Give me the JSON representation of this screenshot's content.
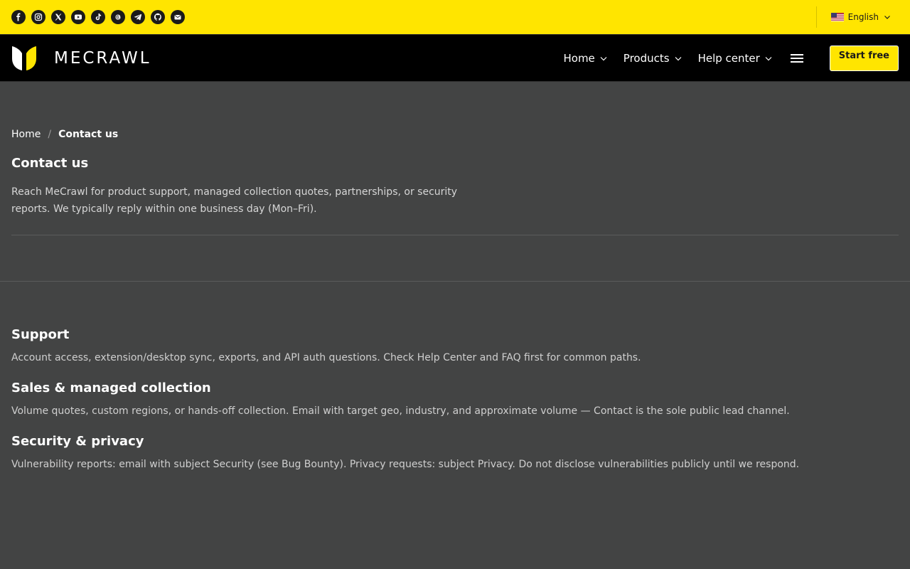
{
  "topbar": {
    "socials": [
      {
        "icon": "facebook-icon"
      },
      {
        "icon": "instagram-icon"
      },
      {
        "icon": "x-twitter-icon"
      },
      {
        "icon": "youtube-icon"
      },
      {
        "icon": "tiktok-icon"
      },
      {
        "icon": "threads-icon"
      },
      {
        "icon": "telegram-icon"
      },
      {
        "icon": "github-icon"
      },
      {
        "icon": "email-icon"
      }
    ],
    "language": {
      "label": "English",
      "flag": "us-flag-icon"
    }
  },
  "nav": {
    "brand": "MECRAWL",
    "links": [
      {
        "label": "Home"
      },
      {
        "label": "Products"
      },
      {
        "label": "Help center"
      }
    ],
    "cta": "Start free"
  },
  "breadcrumb": {
    "home": "Home",
    "separator": "/",
    "current": "Contact us"
  },
  "page": {
    "title": "Contact us",
    "intro": "Reach MeCrawl for product support, managed collection quotes, partnerships, or security reports. We typically reply within one business day (Mon–Fri)."
  },
  "sections": [
    {
      "title": "Support",
      "body": "Account access, extension/desktop sync, exports, and API auth questions. Check Help Center and FAQ first for common paths."
    },
    {
      "title": "Sales & managed collection",
      "body": "Volume quotes, custom regions, or hands-off collection. Email with target geo, industry, and approximate volume — Contact is the sole public lead channel."
    },
    {
      "title": "Security & privacy",
      "body": "Vulnerability reports: email with subject Security (see Bug Bounty). Privacy requests: subject Privacy. Do not disclose vulnerabilities publicly until we respond."
    }
  ],
  "colors": {
    "brand_yellow": "#ffe500",
    "nav_bg": "#000000",
    "page_bg": "#434444"
  }
}
